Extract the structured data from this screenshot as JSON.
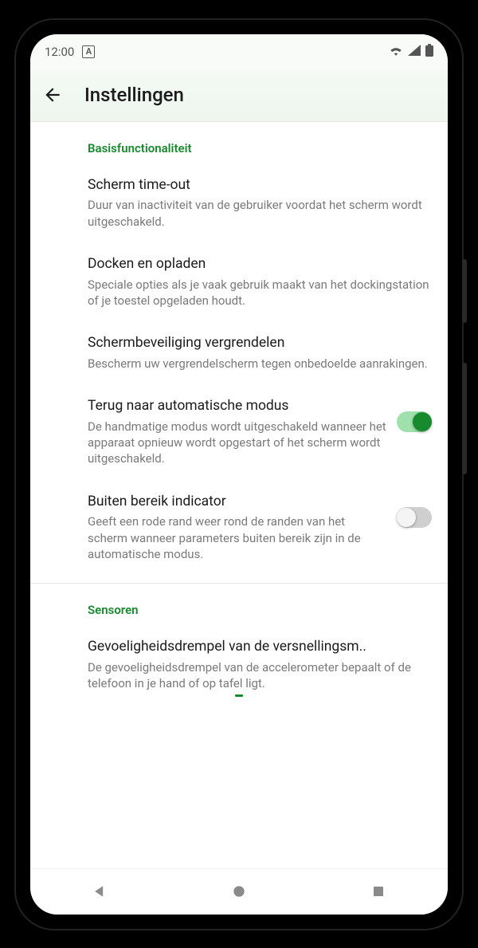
{
  "statusbar": {
    "time": "12:00",
    "badge": "A"
  },
  "appbar": {
    "title": "Instellingen"
  },
  "sections": [
    {
      "header": "Basisfunctionaliteit",
      "items": [
        {
          "key": "screen-timeout",
          "title": "Scherm time-out",
          "desc": "Duur van inactiviteit van de gebruiker voordat het scherm wordt uitgeschakeld.",
          "toggle": null
        },
        {
          "key": "dock-charging",
          "title": "Docken en opladen",
          "desc": "Speciale opties als je vaak gebruik maakt van het dockingstation of je toestel opgeladen houdt.",
          "toggle": null
        },
        {
          "key": "lock-screen-protection",
          "title": "Schermbeveiliging vergrendelen",
          "desc": "Bescherm uw vergrendelscherm tegen onbedoelde aanrakingen.",
          "toggle": null
        },
        {
          "key": "return-auto-mode",
          "title": "Terug naar automatische modus",
          "desc": "De handmatige modus wordt uitgeschakeld wanneer het apparaat opnieuw wordt opgestart of het scherm wordt uitgeschakeld.",
          "toggle": true
        },
        {
          "key": "out-of-range-indicator",
          "title": "Buiten bereik indicator",
          "desc": "Geeft een rode rand weer rond de randen van het scherm wanneer parameters buiten bereik zijn in de automatische modus.",
          "toggle": false
        }
      ]
    },
    {
      "header": "Sensoren",
      "items": [
        {
          "key": "accelerometer-threshold",
          "title": "Gevoeligheidsdrempel van de versnellingsm..",
          "desc": "De gevoeligheidsdrempel van de accelerometer bepaalt of de telefoon in je hand of op tafel ligt.",
          "toggle": null,
          "truncateTitle": true
        }
      ]
    }
  ]
}
